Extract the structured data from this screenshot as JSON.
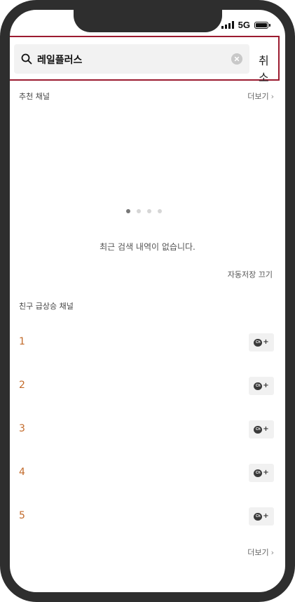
{
  "status_bar": {
    "network": "5G"
  },
  "search": {
    "query": "레일플러스",
    "cancel_label": "취소"
  },
  "recommended": {
    "title": "추천 채널",
    "more_label": "더보기"
  },
  "carousel": {
    "total_dots": 4,
    "active_index": 0
  },
  "recent": {
    "empty_message": "최근 검색 내역이 없습니다.",
    "autosave_label": "자동저장 끄기"
  },
  "trending": {
    "title": "친구 급상승 채널",
    "ranks": [
      "1",
      "2",
      "3",
      "4",
      "5"
    ],
    "add_badge": "Ch",
    "more_label": "더보기"
  },
  "colors": {
    "highlight_border": "#9b1b30",
    "rank_color": "#c26a2a",
    "frame": "#2e2e2e"
  }
}
